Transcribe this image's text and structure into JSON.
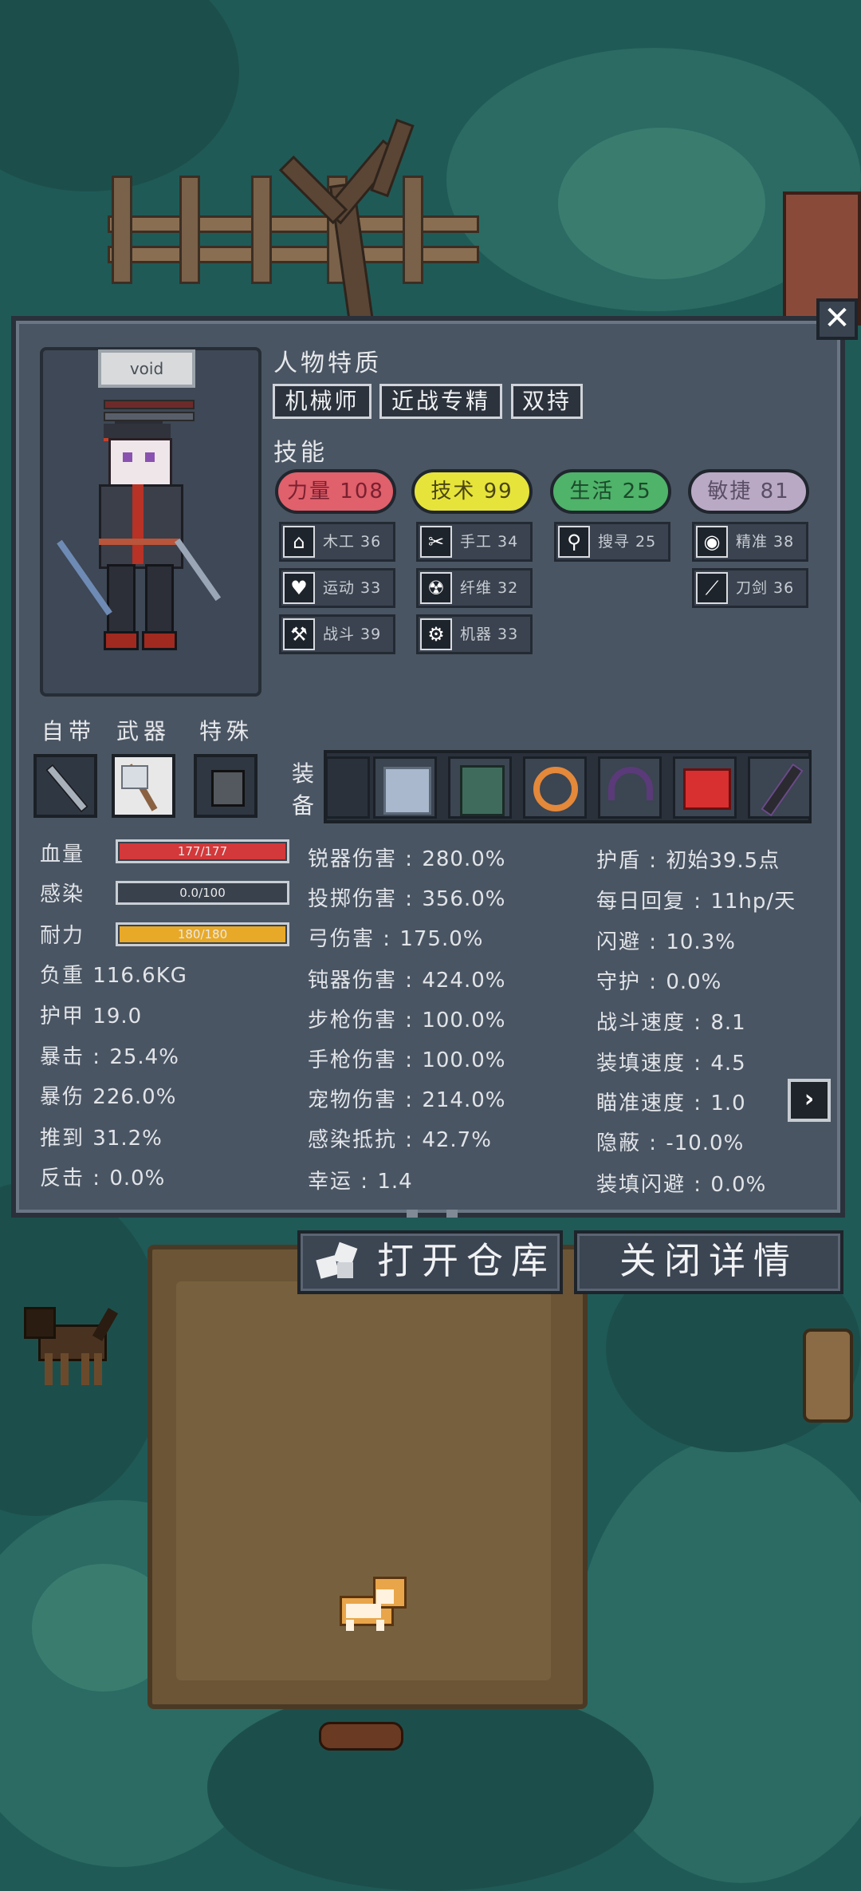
{
  "header": {
    "close_icon": "✕"
  },
  "character": {
    "name": "void"
  },
  "traits": {
    "title": "人物特质",
    "items": [
      "机械师",
      "近战专精",
      "双持"
    ]
  },
  "skills": {
    "title": "技能",
    "main": [
      {
        "label": "力量 108",
        "color": "#e0606b"
      },
      {
        "label": "技术 99",
        "color": "#e6e43a"
      },
      {
        "label": "生活 25",
        "color": "#4fb36a"
      },
      {
        "label": "敏捷 81",
        "color": "#b9a9c4"
      }
    ],
    "sub": [
      {
        "icon": "house-icon",
        "glyph": "⌂",
        "label": "木工 36"
      },
      {
        "icon": "scissors-icon",
        "glyph": "✂",
        "label": "手工 34"
      },
      {
        "icon": "magnifier-icon",
        "glyph": "⚲",
        "label": "搜寻 25"
      },
      {
        "icon": "eye-icon",
        "glyph": "◉",
        "label": "精准 38"
      },
      {
        "icon": "heart-icon",
        "glyph": "♥",
        "label": "运动 33"
      },
      {
        "icon": "radiation-icon",
        "glyph": "☢",
        "label": "纤维 32"
      },
      {
        "icon": "sword-icon",
        "glyph": "⟋",
        "label": "刀剑 36"
      },
      {
        "icon": "axe-icon",
        "glyph": "⚒",
        "label": "战斗 39"
      },
      {
        "icon": "gear-icon",
        "glyph": "⚙",
        "label": "机器 33"
      }
    ]
  },
  "slots": {
    "innate": "自带",
    "weapon": "武器",
    "special": "特殊",
    "equipment": "装备"
  },
  "stats_left": [
    {
      "label": "血量",
      "value": ""
    },
    {
      "label": "感染",
      "value": ""
    },
    {
      "label": "耐力",
      "value": ""
    },
    {
      "label": "负重",
      "value": "116.6KG"
    },
    {
      "label": "护甲",
      "value": "19.0"
    },
    {
      "label": "暴击",
      "value": "25.4%"
    },
    {
      "label": "暴伤",
      "value": "226.0%"
    },
    {
      "label": "推到",
      "value": "31.2%"
    },
    {
      "label": "反击",
      "value": "0.0%"
    }
  ],
  "bars": {
    "hp": {
      "text": "177/177",
      "fraction": 1.0,
      "color": "#d3383a"
    },
    "infection": {
      "text": "0.0/100",
      "fraction": 0.0,
      "color": "#666"
    },
    "stamina": {
      "text": "180/180",
      "fraction": 1.0,
      "color": "#e8a928"
    }
  },
  "stats_mid": [
    {
      "label": "锐器伤害",
      "value": "280.0%"
    },
    {
      "label": "投掷伤害",
      "value": "356.0%"
    },
    {
      "label": "弓伤害",
      "value": "175.0%"
    },
    {
      "label": "钝器伤害",
      "value": "424.0%"
    },
    {
      "label": "步枪伤害",
      "value": "100.0%"
    },
    {
      "label": "手枪伤害",
      "value": "100.0%"
    },
    {
      "label": "宠物伤害",
      "value": "214.0%"
    },
    {
      "label": "感染抵抗",
      "value": "42.7%"
    },
    {
      "label": "幸运",
      "value": "1.4"
    }
  ],
  "stats_right": [
    {
      "label": "护盾",
      "value": "初始39.5点"
    },
    {
      "label": "每日回复",
      "value": "11hp/天"
    },
    {
      "label": "闪避",
      "value": "10.3%"
    },
    {
      "label": "守护",
      "value": "0.0%"
    },
    {
      "label": "战斗速度",
      "value": "8.1"
    },
    {
      "label": "装填速度",
      "value": "4.5"
    },
    {
      "label": "瞄准速度",
      "value": "1.0"
    },
    {
      "label": "隐蔽",
      "value": "-10.0%"
    },
    {
      "label": "装填闪避",
      "value": "0.0%"
    }
  ],
  "buttons": {
    "open_storage": "打开仓库",
    "close_details": "关闭详情",
    "next_icon": "›"
  },
  "colors": {
    "panel": "#4a5563",
    "background": "#1f5a57"
  }
}
